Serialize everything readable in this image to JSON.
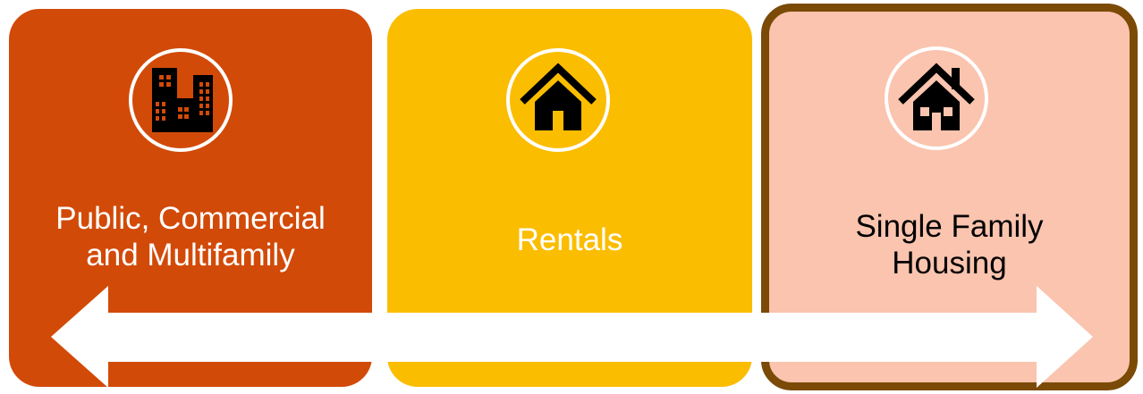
{
  "cards": [
    {
      "line1": "Public, Commercial",
      "line2": "and Multifamily",
      "icon": "buildings-icon",
      "background": "#D24A08",
      "text_color": "#ffffff"
    },
    {
      "line1": "Rentals",
      "line2": "",
      "icon": "house-icon",
      "background": "#FBBD00",
      "text_color": "#ffffff"
    },
    {
      "line1": "Single Family",
      "line2": "Housing",
      "icon": "house-with-chimney-icon",
      "background": "#FAC4AF",
      "border": "#7A4A06",
      "text_color": "#000000"
    }
  ],
  "arrow": {
    "type": "double-headed",
    "color": "#ffffff"
  }
}
